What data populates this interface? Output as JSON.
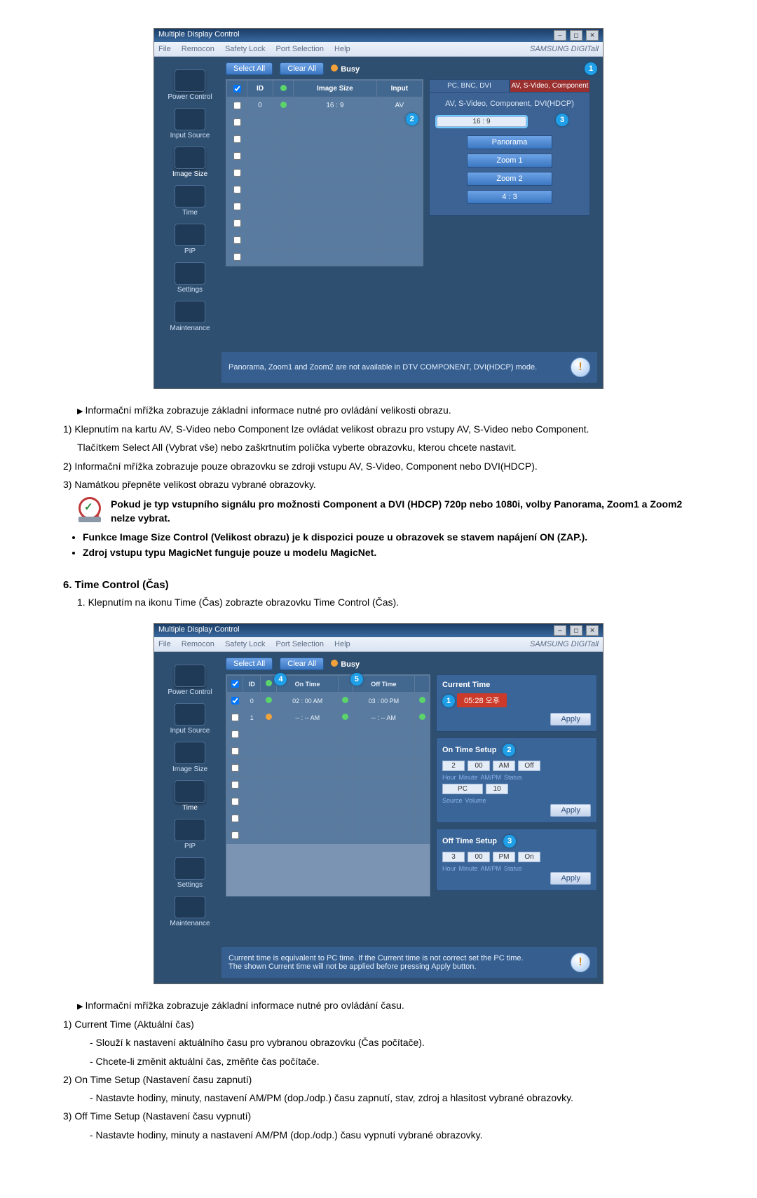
{
  "shot1": {
    "titlebar": "Multiple Display Control",
    "menubar": [
      "File",
      "Remocon",
      "Safety Lock",
      "Port Selection",
      "Help"
    ],
    "brand": "SAMSUNG DIGITall",
    "toolbar": {
      "select_all": "Select All",
      "clear_all": "Clear All",
      "busy": "Busy"
    },
    "sidebar": [
      "Power Control",
      "Input Source",
      "Image Size",
      "Time",
      "PIP",
      "Settings",
      "Maintenance"
    ],
    "grid_headers": [
      "",
      "ID",
      "",
      "Image Size",
      "Input"
    ],
    "grid_row": {
      "id": "0",
      "size": "16 : 9",
      "input": "AV"
    },
    "tabs": {
      "left": "PC, BNC, DVI",
      "right": "AV, S-Video, Component"
    },
    "palette_subtitle": "AV, S-Video, Component, DVI(HDCP)",
    "options": [
      "16 : 9",
      "Panorama",
      "Zoom 1",
      "Zoom 2",
      "4 : 3"
    ],
    "footer": "Panorama, Zoom1 and Zoom2 are not available in DTV COMPONENT, DVI(HDCP) mode.",
    "callouts": {
      "c1": "1",
      "c2": "2",
      "c3": "3"
    }
  },
  "text_after_shot1": {
    "p_arrow": "Informační mřížka zobrazuje základní informace nutné pro ovládání velikosti obrazu.",
    "p1a": "Klepnutím na kartu AV, S-Video nebo Component lze ovládat velikost obrazu pro vstupy AV, S-Video nebo Component.",
    "p1b": "Tlačítkem Select All (Vybrat vše) nebo zaškrtnutím políčka vyberte obrazovku, kterou chcete nastavit.",
    "p2": "Informační mřížka zobrazuje pouze obrazovku se zdroji vstupu AV, S-Video, Component nebo DVI(HDCP).",
    "p3": "Namátkou přepněte velikost obrazu vybrané obrazovky.",
    "note": "Pokud je typ vstupního signálu pro možnosti Component a DVI (HDCP) 720p nebo 1080i, volby Panorama, Zoom1 a Zoom2 nelze vybrat.",
    "bullet1": "Funkce Image Size Control (Velikost obrazu) je k dispozici pouze u obrazovek se stavem napájení ON (ZAP.).",
    "bullet2": "Zdroj vstupu typu MagicNet funguje pouze u modelu MagicNet."
  },
  "section2_heading": "6. Time Control (Čas)",
  "section2_intro": "1.  Klepnutím na ikonu Time (Čas) zobrazte obrazovku Time Control (Čas).",
  "shot2": {
    "titlebar": "Multiple Display Control",
    "menubar": [
      "File",
      "Remocon",
      "Safety Lock",
      "Port Selection",
      "Help"
    ],
    "brand": "SAMSUNG DIGITall",
    "toolbar": {
      "select_all": "Select All",
      "clear_all": "Clear All",
      "busy": "Busy"
    },
    "sidebar": [
      "Power Control",
      "Input Source",
      "Image Size",
      "Time",
      "PIP",
      "Settings",
      "Maintenance"
    ],
    "grid_headers": [
      "",
      "ID",
      "",
      "On Time",
      "",
      "Off Time",
      ""
    ],
    "rows": [
      {
        "id": "0",
        "on": "02 : 00  AM",
        "off": "03 : 00  PM"
      },
      {
        "id": "1",
        "on": "-- : --  AM",
        "off": "-- : --  AM"
      }
    ],
    "current_time": {
      "hdr": "Current Time",
      "value": "05:28 오후",
      "apply": "Apply"
    },
    "on_setup": {
      "hdr": "On Time Setup",
      "hour": "2",
      "minute": "00",
      "ampm": "AM",
      "status": "Off",
      "source": "PC",
      "volume": "10",
      "labels": {
        "hour": "Hour",
        "minute": "Minute",
        "ampm": "AM/PM",
        "status": "Status",
        "source": "Source",
        "volume": "Volume"
      },
      "apply": "Apply"
    },
    "off_setup": {
      "hdr": "Off Time Setup",
      "hour": "3",
      "minute": "00",
      "ampm": "PM",
      "status": "On",
      "labels": {
        "hour": "Hour",
        "minute": "Minute",
        "ampm": "AM/PM",
        "status": "Status"
      },
      "apply": "Apply"
    },
    "footer_l1": "Current time is equivalent to PC time. If the Current time is not correct set the PC time.",
    "footer_l2": "The shown Current time will not be applied before pressing Apply button.",
    "callouts": {
      "c1": "1",
      "c2": "2",
      "c3": "3",
      "c4": "4",
      "c5": "5"
    }
  },
  "text_after_shot2": {
    "p_arrow": "Informační mřížka zobrazuje základní informace nutné pro ovládání času.",
    "h1": "Current Time (Aktuální čas)",
    "h1a": "- Slouží k nastavení aktuálního času pro vybranou obrazovku (Čas počítače).",
    "h1b": "- Chcete-li změnit aktuální čas, změňte čas počítače.",
    "h2": "On Time Setup (Nastavení času zapnutí)",
    "h2a": "Nastavte hodiny, minuty, nastavení AM/PM (dop./odp.) času zapnutí, stav, zdroj a hlasitost vybrané obrazovky.",
    "h3": "Off Time Setup (Nastavení času vypnutí)",
    "h3a": "- Nastavte hodiny, minuty a nastavení AM/PM (dop./odp.) času vypnutí vybrané obrazovky."
  },
  "labels": {
    "n1": "1)",
    "n2": "2)",
    "n3": "3)",
    "dash": "-"
  }
}
